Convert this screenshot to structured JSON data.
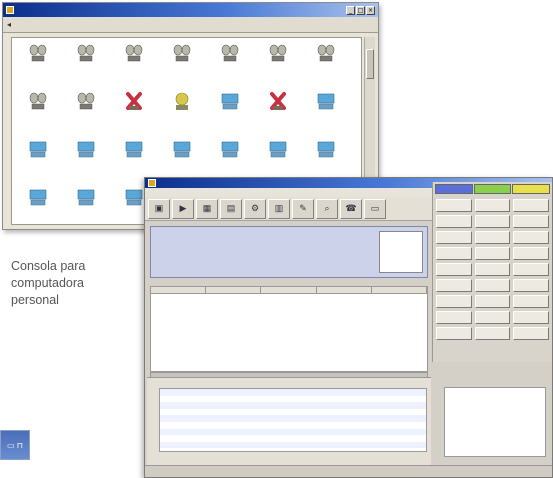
{
  "caption": {
    "line1": "Consola para",
    "line2": "computadora",
    "line3": "personal"
  },
  "back_window": {
    "title": "",
    "tabs": [
      "",
      "",
      "",
      "",
      "",
      "",
      "",
      ""
    ],
    "devices": [
      {
        "icon": "camera-dome-icon",
        "label": ""
      },
      {
        "icon": "camera-dome-icon",
        "label": ""
      },
      {
        "icon": "camera-dome-icon",
        "label": ""
      },
      {
        "icon": "camera-dome-icon",
        "label": ""
      },
      {
        "icon": "camera-dome-icon",
        "label": ""
      },
      {
        "icon": "camera-dome-icon",
        "label": ""
      },
      {
        "icon": "camera-dome-icon",
        "label": ""
      },
      {
        "icon": "camera-dome-icon",
        "label": ""
      },
      {
        "icon": "camera-dome-icon",
        "label": ""
      },
      {
        "icon": "camera-alarm-icon",
        "label": ""
      },
      {
        "icon": "camera-warning-icon",
        "label": ""
      },
      {
        "icon": "monitor-icon",
        "label": ""
      },
      {
        "icon": "camera-alarm-icon",
        "label": ""
      },
      {
        "icon": "monitor-icon",
        "label": ""
      },
      {
        "icon": "monitor-icon",
        "label": ""
      },
      {
        "icon": "monitor-icon",
        "label": ""
      },
      {
        "icon": "monitor-icon",
        "label": ""
      },
      {
        "icon": "monitor-icon",
        "label": ""
      },
      {
        "icon": "monitor-icon",
        "label": ""
      },
      {
        "icon": "monitor-icon",
        "label": ""
      },
      {
        "icon": "monitor-icon",
        "label": ""
      },
      {
        "icon": "monitor-icon",
        "label": ""
      },
      {
        "icon": "monitor-icon",
        "label": ""
      },
      {
        "icon": "monitor-icon",
        "label": ""
      }
    ]
  },
  "front_window": {
    "title": "",
    "menu": [
      "",
      "",
      ""
    ],
    "tab_colors": [
      "#5a6fd8",
      "#8ad04a",
      "#e8e04a"
    ],
    "grid_row_numbers": [
      "",
      "",
      "",
      "",
      "",
      "",
      "",
      "",
      "",
      "",
      ""
    ],
    "button_count": 27
  },
  "colors": {
    "titlebar": "#0b2e8c",
    "camera_yellow": "#d8c84a",
    "camera_red": "#c83040",
    "monitor_blue": "#5aa8d8"
  }
}
